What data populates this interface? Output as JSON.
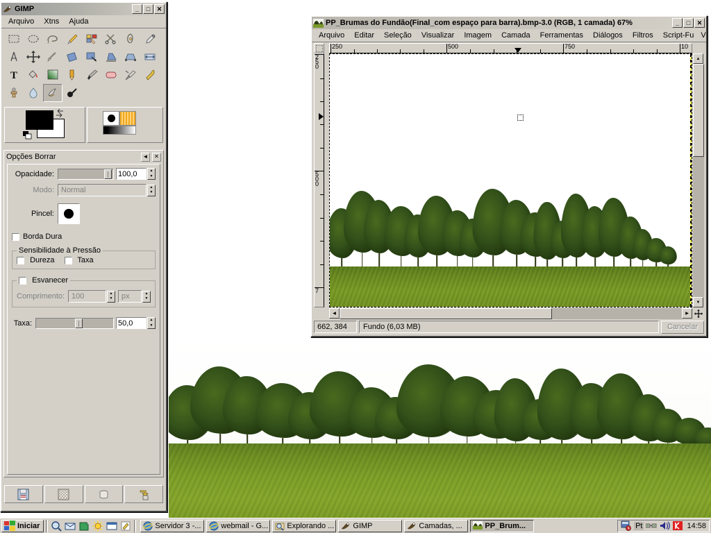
{
  "toolbox": {
    "title": "GIMP",
    "window_buttons": {
      "minimize": "_",
      "maximize": "□",
      "close": "✕"
    },
    "menu": [
      {
        "label": "Arquivo",
        "accel": "A"
      },
      {
        "label": "Xtns",
        "accel": "X"
      },
      {
        "label": "Ajuda",
        "accel": "j"
      }
    ],
    "tools": [
      "rect-select-icon",
      "ellipse-select-icon",
      "free-select-icon",
      "fuzzy-select-icon",
      "select-by-color-icon",
      "scissors-select-icon",
      "paths-icon",
      "color-picker-icon",
      "zoom-icon",
      "measure-icon",
      "move-icon",
      "crop-icon",
      "rotate-icon",
      "scale-icon",
      "shear-icon",
      "perspective-icon",
      "flip-icon",
      "text-icon",
      "bucket-fill-icon",
      "gradient-icon",
      "pencil-icon",
      "paintbrush-icon",
      "eraser-icon",
      "airbrush-icon",
      "ink-icon",
      "clone-icon",
      "blur-sharpen-icon",
      "smudge-icon",
      "dodge-burn-icon"
    ],
    "selected_tool": "smudge-icon",
    "colors": {
      "foreground": "#000000",
      "background": "#ffffff",
      "brush": "circle-brush",
      "pattern": "orange-stripes-pattern",
      "gradient": "black-to-white-gradient"
    }
  },
  "tool_options": {
    "title": "Opções Borrar",
    "collapse_icon": "◄",
    "close_icon": "✕",
    "opacity": {
      "label": "Opacidade:",
      "value": "100,0"
    },
    "mode": {
      "label": "Modo:",
      "value": "Normal"
    },
    "brush": {
      "label": "Pincel:"
    },
    "hard_edge": {
      "label": "Borda Dura",
      "checked": false
    },
    "pressure_sensitivity": {
      "legend": "Sensibilidade à Pressão",
      "items": [
        {
          "label": "Dureza",
          "checked": false
        },
        {
          "label": "Taxa",
          "checked": false
        }
      ]
    },
    "fade_out": {
      "legend": "Esvanecer",
      "checked": false,
      "length": {
        "label": "Comprimento:",
        "value": "100"
      },
      "unit": "px"
    },
    "rate": {
      "label": "Taxa:",
      "value": "50,0"
    },
    "footer_buttons": [
      "save-options-icon",
      "restore-options-icon",
      "delete-options-icon",
      "reset-options-icon"
    ]
  },
  "image_window": {
    "title": "PP_Brumas do Fundão(Final_com espaço para barra).bmp-3.0 (RGB, 1 camada) 67%",
    "window_buttons": {
      "minimize": "_",
      "maximize": "□",
      "close": "✕"
    },
    "menu": [
      {
        "label": "Arquivo",
        "accel": "A"
      },
      {
        "label": "Editar",
        "accel": "E"
      },
      {
        "label": "Seleção",
        "accel": "S"
      },
      {
        "label": "Visualizar",
        "accel": "V"
      },
      {
        "label": "Imagem",
        "accel": "I"
      },
      {
        "label": "Camada",
        "accel": "C"
      },
      {
        "label": "Ferramentas",
        "accel": "F"
      },
      {
        "label": "Diálogos",
        "accel": "l"
      },
      {
        "label": "Filtros",
        "accel": "t"
      },
      {
        "label": "Script-Fu",
        "accel": ""
      },
      {
        "label": "V",
        "accel": ""
      }
    ],
    "ruler_h_labels": [
      "250",
      "500",
      "750",
      "10"
    ],
    "ruler_v_labels": [
      "250",
      "500",
      "7"
    ],
    "statusbar": {
      "position": "662, 384",
      "message": "Fundo (6,03 MB)",
      "cancel_label": "Cancelar"
    },
    "quickmask_icon": "quickmask-icon",
    "navigation_icon": "navigation-icon"
  },
  "taskbar": {
    "start_label": "Iniciar",
    "quick_launch": [
      "search-icon",
      "email-icon",
      "notepad-icon",
      "display-icon",
      "window-icon",
      "paint-icon"
    ],
    "tasks": [
      {
        "label": "Servidor 3 -...",
        "icon": "ie-icon",
        "active": false
      },
      {
        "label": "webmail - G...",
        "icon": "ie-icon",
        "active": false
      },
      {
        "label": "Explorando ...",
        "icon": "explorer-icon",
        "active": false
      },
      {
        "label": "GIMP",
        "icon": "gimp-icon",
        "active": false
      },
      {
        "label": "Camadas, ...",
        "icon": "gimp-icon",
        "active": false
      },
      {
        "label": "PP_Brum...",
        "icon": "image-icon",
        "active": true
      }
    ],
    "tray": {
      "icons": [
        "scheduler-icon",
        "network-icon",
        "volume-icon",
        "kaspersky-icon"
      ],
      "language": "Pt",
      "clock": "14:58"
    }
  }
}
